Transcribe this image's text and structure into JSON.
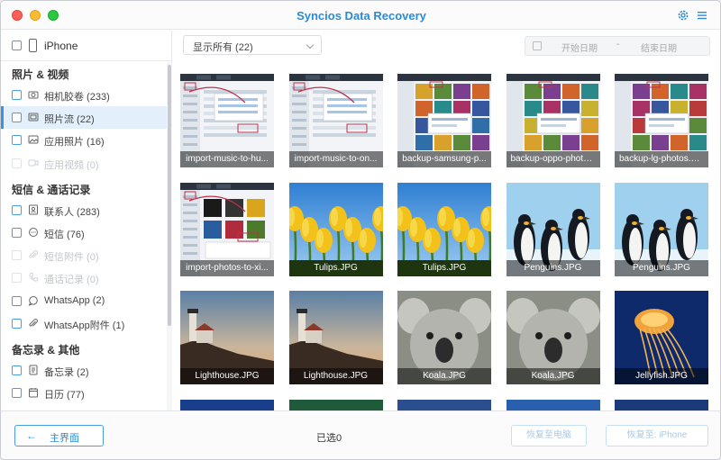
{
  "app": {
    "title": "Syncios Data Recovery"
  },
  "device": {
    "name": "iPhone"
  },
  "sidebar": {
    "sections": [
      {
        "title": "照片 & 视频",
        "items": [
          {
            "label": "相机胶卷 (233)",
            "icon": "camera-icon",
            "enabled": true,
            "selected": false
          },
          {
            "label": "照片流 (22)",
            "icon": "photo-stream-icon",
            "enabled": true,
            "selected": true
          },
          {
            "label": "应用照片 (16)",
            "icon": "image-icon",
            "enabled": true,
            "selected": false
          },
          {
            "label": "应用视频 (0)",
            "icon": "video-icon",
            "enabled": false,
            "selected": false
          }
        ]
      },
      {
        "title": "短信 & 通话记录",
        "items": [
          {
            "label": "联系人 (283)",
            "icon": "contact-icon",
            "enabled": true,
            "selected": false
          },
          {
            "label": "短信 (76)",
            "icon": "message-icon",
            "enabled": true,
            "selected": false
          },
          {
            "label": "短信附件 (0)",
            "icon": "attachment-icon",
            "enabled": false,
            "selected": false
          },
          {
            "label": "通话记录 (0)",
            "icon": "phone-call-icon",
            "enabled": false,
            "selected": false
          },
          {
            "label": "WhatsApp (2)",
            "icon": "whatsapp-icon",
            "enabled": true,
            "selected": false
          },
          {
            "label": "WhatsApp附件 (1)",
            "icon": "attachment-icon",
            "enabled": true,
            "selected": false
          }
        ]
      },
      {
        "title": "备忘录 & 其他",
        "items": [
          {
            "label": "备忘录 (2)",
            "icon": "notes-icon",
            "enabled": true,
            "selected": false
          },
          {
            "label": "日历 (77)",
            "icon": "calendar-icon",
            "enabled": true,
            "selected": false
          }
        ]
      }
    ]
  },
  "toolbar": {
    "filter_value": "显示所有 (22)",
    "start_date_placeholder": "开始日期",
    "date_separator": "-",
    "end_date_placeholder": "结束日期"
  },
  "photos": [
    {
      "name": "import-music-to-hu...",
      "kind": "screenshot"
    },
    {
      "name": "import-music-to-on...",
      "kind": "screenshot"
    },
    {
      "name": "backup-samsung-p...",
      "kind": "collage"
    },
    {
      "name": "backup-oppo-photo...",
      "kind": "collage"
    },
    {
      "name": "backup-lg-photos.JPG",
      "kind": "collage"
    },
    {
      "name": "import-photos-to-xi...",
      "kind": "screenshot"
    },
    {
      "name": "Tulips.JPG",
      "kind": "tulips"
    },
    {
      "name": "Tulips.JPG",
      "kind": "tulips"
    },
    {
      "name": "Penguins.JPG",
      "kind": "penguins"
    },
    {
      "name": "Penguins.JPG",
      "kind": "penguins"
    },
    {
      "name": "Lighthouse.JPG",
      "kind": "lighthouse"
    },
    {
      "name": "Lighthouse.JPG",
      "kind": "lighthouse"
    },
    {
      "name": "Koala.JPG",
      "kind": "koala"
    },
    {
      "name": "Koala.JPG",
      "kind": "koala"
    },
    {
      "name": "Jellyfish.JPG",
      "kind": "jellyfish"
    }
  ],
  "footer": {
    "home_label": "主界面",
    "selected_label": "已选0",
    "recover_pc_label": "恢复至电脑",
    "recover_iphone_label": "恢复至: iPhone"
  },
  "colors": {
    "accent": "#2b8bd6",
    "selection": "#e3f0fb"
  }
}
